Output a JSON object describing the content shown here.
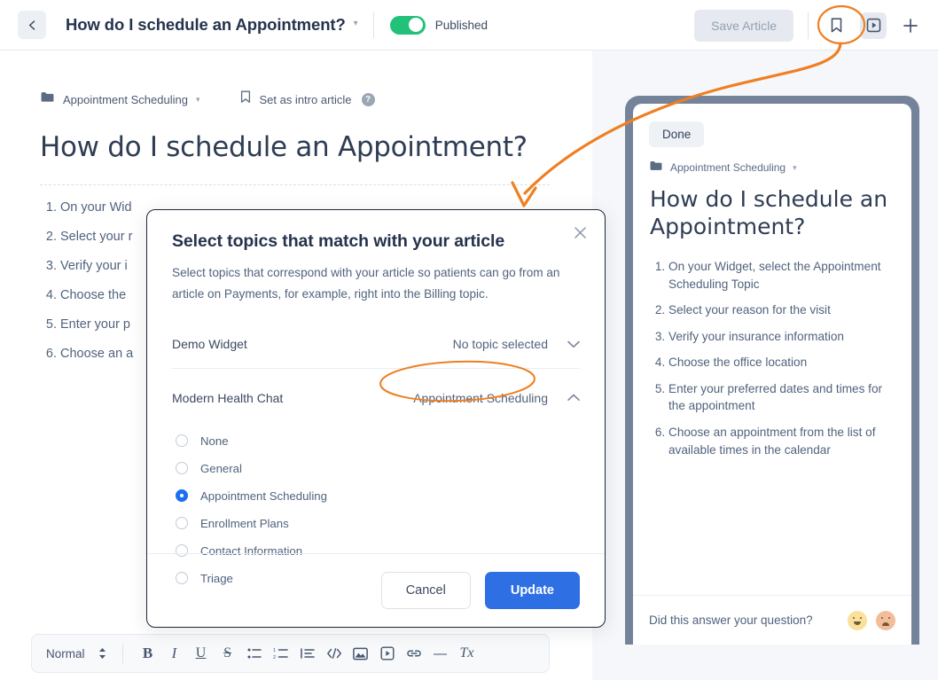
{
  "header": {
    "back_icon": "chevron-left-icon",
    "title": "How do I schedule an Appointment?",
    "title_caret": "▾",
    "published_label": "Published",
    "save_label": "Save Article",
    "bookmark_icon": "bookmark-icon",
    "video_icon": "video-play-icon",
    "plus_icon": "plus-icon"
  },
  "editor": {
    "category": "Appointment Scheduling",
    "category_caret": "▾",
    "intro_label": "Set as intro article",
    "intro_icon": "bookmark-outline-icon",
    "help_icon": "question-mark-icon",
    "help_glyph": "?",
    "title": "How do I schedule an Appointment?",
    "steps": [
      "On your Wid",
      "Select your r",
      "Verify your i",
      "Choose the ",
      "Enter your p",
      "Choose an a"
    ]
  },
  "toolbar": {
    "style_value": "Normal",
    "stepper_icon": "updown-stepper-icon",
    "buttons": [
      {
        "name": "bold-button",
        "glyph": "B"
      },
      {
        "name": "italic-button",
        "glyph": "I"
      },
      {
        "name": "underline-button",
        "glyph": "U"
      },
      {
        "name": "strikethrough-button",
        "glyph": "S"
      },
      {
        "name": "bullet-list-button",
        "glyph": "•≡"
      },
      {
        "name": "numbered-list-button",
        "glyph": "1≡"
      },
      {
        "name": "align-list-button",
        "glyph": "|≡"
      },
      {
        "name": "code-block-button",
        "glyph": "</>"
      },
      {
        "name": "insert-image-button",
        "glyph": "▣"
      },
      {
        "name": "insert-video-button",
        "glyph": "▶"
      },
      {
        "name": "insert-link-button",
        "glyph": "🔗"
      },
      {
        "name": "horizontal-rule-button",
        "glyph": "—"
      },
      {
        "name": "clear-format-button",
        "glyph": "Tx"
      }
    ]
  },
  "modal": {
    "title": "Select topics that match with your article",
    "subtitle": "Select topics that correspond with your article so patients can go from an article on Payments, for example, right into the Billing topic.",
    "close_icon": "close-icon",
    "rows": [
      {
        "label": "Demo Widget",
        "value": "No topic selected",
        "chevron": "chevron-down-icon",
        "expanded": false
      },
      {
        "label": "Modern Health Chat",
        "value": "Appointment Scheduling",
        "chevron": "chevron-up-icon",
        "expanded": true
      }
    ],
    "options": [
      {
        "label": "None",
        "selected": false
      },
      {
        "label": "General",
        "selected": false
      },
      {
        "label": "Appointment Scheduling",
        "selected": true
      },
      {
        "label": "Enrollment Plans",
        "selected": false
      },
      {
        "label": "Contact Information",
        "selected": false
      },
      {
        "label": "Triage",
        "selected": false
      }
    ],
    "cancel_label": "Cancel",
    "update_label": "Update"
  },
  "preview": {
    "done_label": "Done",
    "category": "Appointment Scheduling",
    "category_caret": "▾",
    "title": "How do I schedule an Appointment?",
    "steps": [
      "On your Widget, select the Appointment Scheduling Topic",
      "Select your reason for the visit",
      "Verify your insurance information",
      "Choose the office location",
      "Enter your preferred dates and times for the appointment",
      "Choose an appointment from the list of available times in the calendar"
    ],
    "footer_question": "Did this answer your question?",
    "happy_icon": "happy-face-icon",
    "sad_icon": "sad-face-icon"
  },
  "annotation": {
    "color": "#ef7f21",
    "circle_target": "bookmark-icon",
    "ellipse_target": "appointment-scheduling-value",
    "arrow": "curved-arrow-annotation"
  },
  "colors": {
    "accent_blue": "#2f6fe4",
    "toggle_green": "#21c17a",
    "annotation_orange": "#ef7f21",
    "text_dark": "#25334d",
    "text_muted": "#51637d"
  }
}
